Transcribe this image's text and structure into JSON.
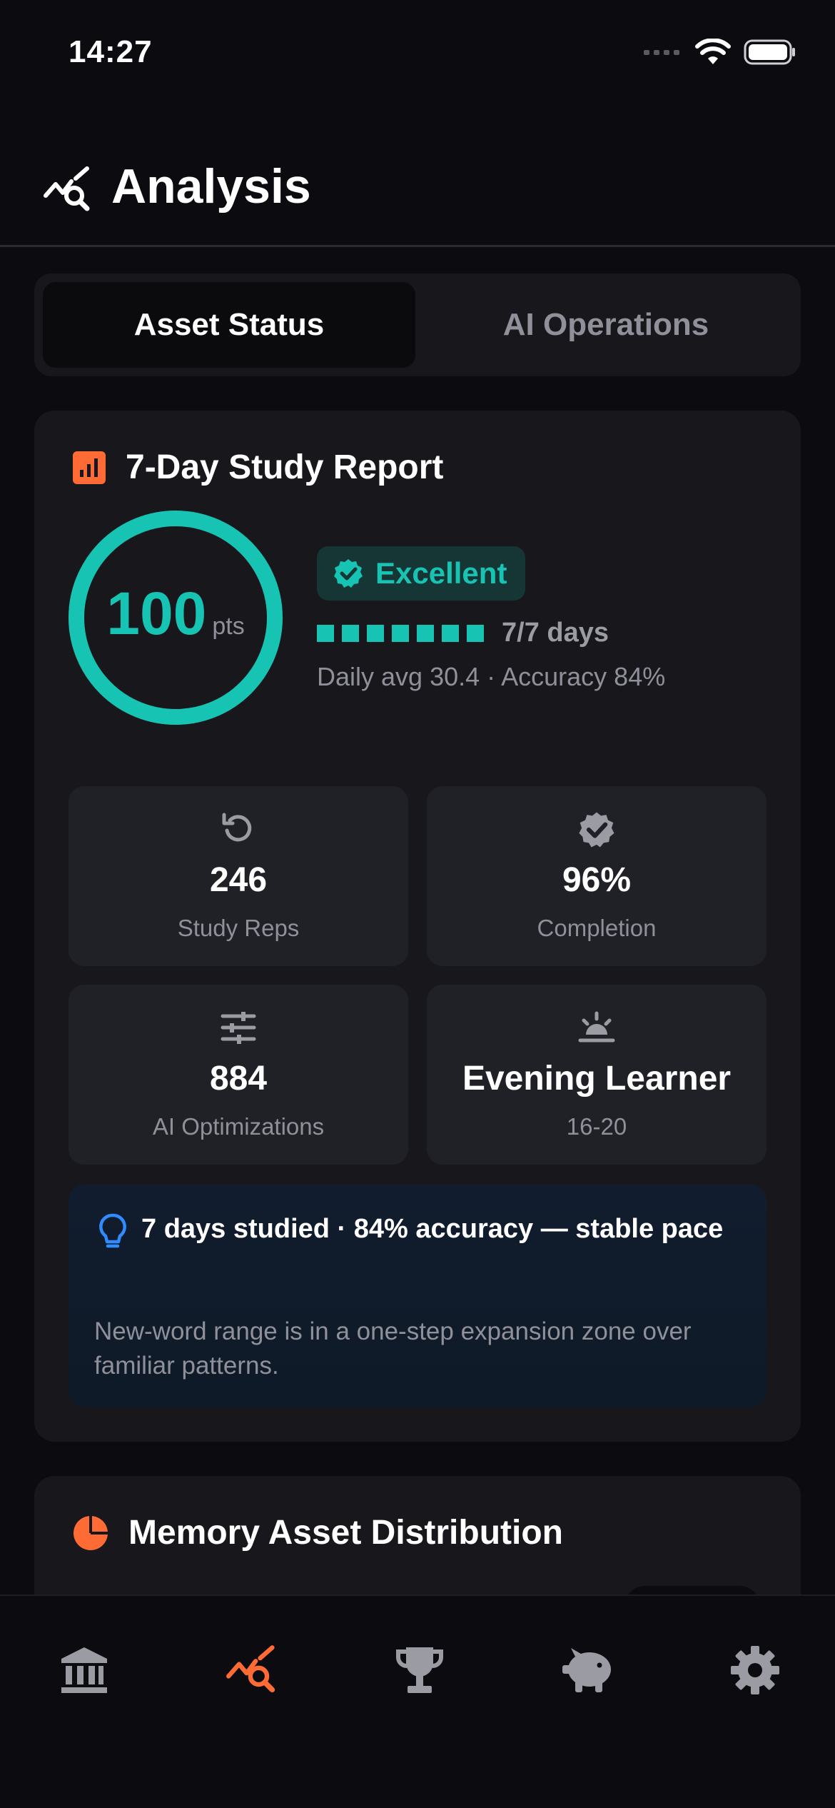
{
  "status_bar": {
    "time": "14:27"
  },
  "header": {
    "title": "Analysis",
    "icon": "analytics-search-icon"
  },
  "segments": [
    {
      "label": "Asset Status",
      "active": true
    },
    {
      "label": "AI Operations",
      "active": false
    }
  ],
  "report": {
    "title": "7-Day Study Report",
    "title_icon": "bar-chart-icon",
    "score": {
      "value": "100",
      "unit": "pts",
      "fraction": 1.0
    },
    "badge": {
      "label": "Excellent",
      "icon": "verified-badge-icon"
    },
    "days": {
      "studied": 7,
      "total": 7,
      "label": "7/7 days"
    },
    "stats_line": "Daily avg 30.4 · Accuracy 84%",
    "tiles": [
      {
        "value": "246",
        "label": "Study Reps",
        "icon": "replay-icon"
      },
      {
        "value": "96%",
        "label": "Completion",
        "icon": "verified-icon"
      },
      {
        "value": "884",
        "label": "AI Optimizations",
        "icon": "sliders-icon"
      },
      {
        "value": "Evening Learner",
        "label": "16-20",
        "icon": "sunset-icon"
      }
    ],
    "insight": {
      "icon": "lightbulb-icon",
      "title": "7 days studied · 84% accuracy — stable pace",
      "body": "New-word range is in a one-step expansion zone over familiar patterns."
    }
  },
  "memory": {
    "title": "Memory Asset Distribution",
    "icon": "pie-chart-icon"
  },
  "tabbar": {
    "items": [
      {
        "name": "bank-icon",
        "active": false
      },
      {
        "name": "analytics-search-icon",
        "active": true
      },
      {
        "name": "trophy-icon",
        "active": false
      },
      {
        "name": "piggy-bank-icon",
        "active": false
      },
      {
        "name": "gear-icon",
        "active": false
      }
    ]
  },
  "colors": {
    "accent_teal": "#17c3b2",
    "accent_orange": "#ff6b35",
    "background": "#0c0c10",
    "card": "#17171c",
    "tile": "#202027",
    "muted_text": "#8f9099",
    "insight_blue": "#2f8cff"
  }
}
